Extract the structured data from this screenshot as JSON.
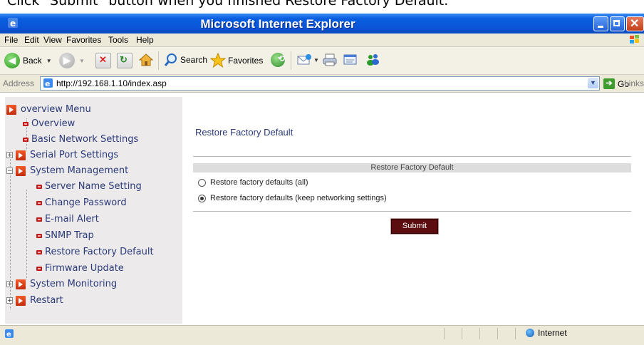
{
  "caption": "Click \"Submit\" button when you finished Restore Factory Default.",
  "window": {
    "title": "Microsoft Internet Explorer"
  },
  "menu": [
    "File",
    "Edit",
    "View",
    "Favorites",
    "Tools",
    "Help"
  ],
  "toolbar": {
    "back": "Back",
    "search": "Search",
    "favorites": "Favorites"
  },
  "address": {
    "label": "Address",
    "url": "http://192.168.1.10/index.asp",
    "go": "Go",
    "links": "Links"
  },
  "sidebar": {
    "items": [
      {
        "label": "overview Menu",
        "icon": "book-icon",
        "expand": ""
      },
      {
        "label": "Overview",
        "icon": "dot-icon"
      },
      {
        "label": "Basic Network Settings",
        "icon": "dot-icon"
      },
      {
        "label": "Serial Port Settings",
        "icon": "book-icon",
        "expand": "+"
      },
      {
        "label": "System Management",
        "icon": "book-icon",
        "expand": "−"
      },
      {
        "label": "Server Name Setting",
        "icon": "dot-icon"
      },
      {
        "label": "Change Password",
        "icon": "dot-icon"
      },
      {
        "label": "E-mail Alert",
        "icon": "dot-icon"
      },
      {
        "label": "SNMP Trap",
        "icon": "dot-icon"
      },
      {
        "label": "Restore Factory Default",
        "icon": "dot-icon"
      },
      {
        "label": "Firmware Update",
        "icon": "dot-icon"
      },
      {
        "label": "System Monitoring",
        "icon": "book-icon",
        "expand": "+"
      },
      {
        "label": "Restart",
        "icon": "book-icon",
        "expand": "+"
      }
    ]
  },
  "main": {
    "title": "Restore Factory Default",
    "panel_header": "Restore Factory Default",
    "options": [
      {
        "label": "Restore factory defaults (all)",
        "selected": false
      },
      {
        "label": "Restore factory defaults (keep networking settings)",
        "selected": true
      }
    ],
    "submit": "Submit"
  },
  "status": {
    "zone": "Internet"
  }
}
